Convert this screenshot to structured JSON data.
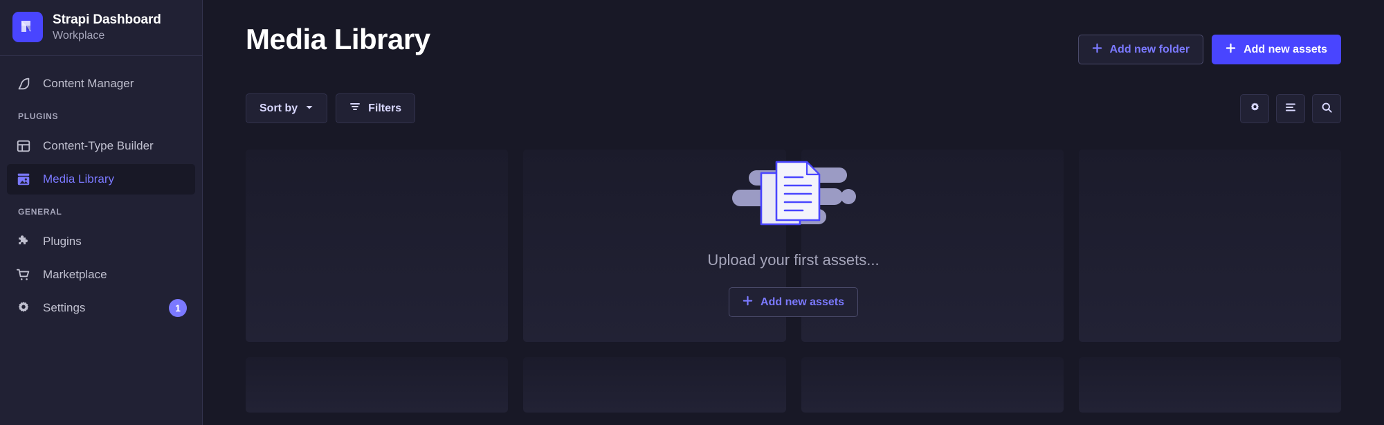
{
  "sidebar": {
    "brand": {
      "title": "Strapi Dashboard",
      "subtitle": "Workplace",
      "logo_icon": "strapi-logo-icon",
      "logo_color": "#4945ff"
    },
    "top_items": [
      {
        "label": "Content Manager",
        "icon": "feather-pen-icon",
        "active": false
      }
    ],
    "sections": [
      {
        "label": "PLUGINS",
        "items": [
          {
            "label": "Content-Type Builder",
            "icon": "layout-grid-icon",
            "active": false
          },
          {
            "label": "Media Library",
            "icon": "image-icon",
            "active": true
          }
        ]
      },
      {
        "label": "GENERAL",
        "items": [
          {
            "label": "Plugins",
            "icon": "puzzle-icon",
            "active": false,
            "badge": ""
          },
          {
            "label": "Marketplace",
            "icon": "shopping-cart-icon",
            "active": false,
            "badge": ""
          },
          {
            "label": "Settings",
            "icon": "gear-icon",
            "active": false,
            "badge": "1"
          }
        ]
      }
    ],
    "active_color": "#7b79ff",
    "badge_color": "#7b79ff"
  },
  "header": {
    "title": "Media Library",
    "add_folder_label": "Add new folder",
    "add_folder_icon": "plus-icon",
    "add_assets_label": "Add new assets",
    "add_assets_icon": "plus-icon",
    "primary_color": "#4945ff"
  },
  "toolbar": {
    "sort_label": "Sort by",
    "sort_icon": "chevron-down-icon",
    "filters_label": "Filters",
    "filters_icon": "filter-icon",
    "settings_icon": "gear-icon",
    "list_view_icon": "list-icon",
    "search_icon": "search-icon"
  },
  "empty_state": {
    "illustration_icon": "documents-illustration-icon",
    "message": "Upload your first assets...",
    "button_label": "Add new assets",
    "button_icon": "plus-icon"
  },
  "grid": {
    "row1_cards": [
      "",
      "",
      "",
      ""
    ],
    "row2_cards": [
      "",
      "",
      "",
      ""
    ]
  }
}
